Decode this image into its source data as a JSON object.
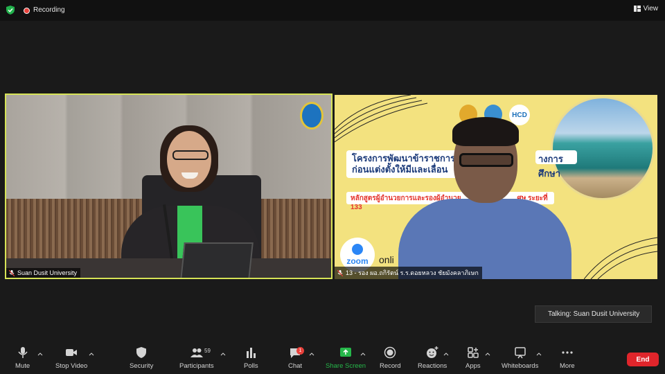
{
  "topbar": {
    "recording_label": "Recording",
    "view_label": "View"
  },
  "participants": [
    {
      "name": "Suan Dusit University",
      "muted": true
    },
    {
      "name": "13 - รอง ผอ.ถกิรัตน์ ร.ร.ดอยหลวง ชัยมังคลาภิเษก",
      "muted": true
    }
  ],
  "shared_slide": {
    "title_line1": "โครงการพัฒนาข้าราชการ",
    "title_line1_end": "างการศึกษา",
    "title_line2": "ก่อนแต่งตั้งให้มีและเลื่อน",
    "subtitle_start": "หลักสูตรผู้อำนวยการและรองผู้อำนวย",
    "subtitle_end": "ศษ ระยะที่ 133",
    "hcd_logo": "HCD",
    "zoom_logo": "zoom",
    "online_text": "onli"
  },
  "talking_indicator": "Talking: Suan Dusit University",
  "toolbar": {
    "mute": "Mute",
    "stop_video": "Stop Video",
    "security": "Security",
    "participants": "Participants",
    "participants_count": "59",
    "polls": "Polls",
    "chat": "Chat",
    "chat_badge": "1",
    "share_screen": "Share Screen",
    "record": "Record",
    "reactions": "Reactions",
    "apps": "Apps",
    "whiteboards": "Whiteboards",
    "more": "More",
    "end": "End"
  },
  "colors": {
    "active_speaker_border": "#d6e356",
    "share_green": "#26b84a",
    "end_red": "#e0252b",
    "record_red": "#e8413b"
  }
}
